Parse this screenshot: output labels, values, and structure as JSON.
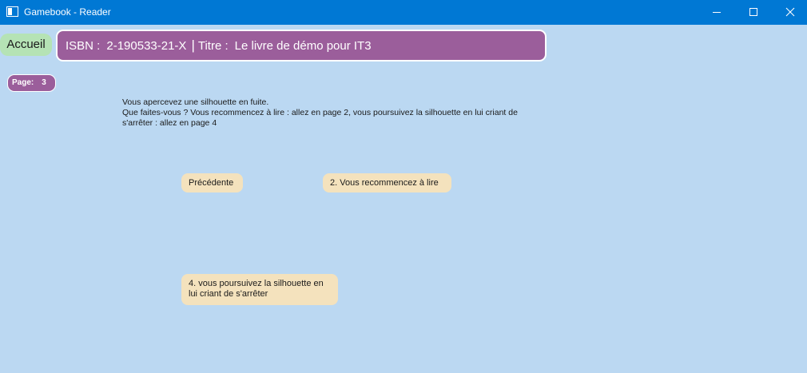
{
  "window": {
    "title": "Gamebook - Reader",
    "icon": "app-window-icon",
    "controls": [
      "minimize-icon",
      "maximize-icon",
      "close-icon"
    ],
    "titlebar_color": "#0078d4"
  },
  "header": {
    "home_label": "Accueil",
    "isbn_label": "ISBN :",
    "isbn_value": "2-190533-21-X",
    "separator": "|",
    "title_label": "Titre :",
    "title_value": "Le livre de démo pour IT3"
  },
  "page": {
    "label": "Page:",
    "number": "3"
  },
  "story": {
    "lines": [
      "Vous apercevez une silhouette en fuite.",
      "Que faites-vous ? Vous recommencez à lire : allez en page 2, vous poursuivez la silhouette en lui criant de s'arrêter : allez en page 4"
    ]
  },
  "choices": {
    "previous": "Précédente",
    "option_page2": "2. Vous recommencez à lire",
    "option_page4": "4. vous poursuivez la silhouette en lui criant de s'arrêter"
  },
  "colors": {
    "background": "#bbd8f2",
    "accent_purple": "#9b5e9b",
    "home_green": "#b5e3b5",
    "choice_beige": "#f4e2bd"
  }
}
